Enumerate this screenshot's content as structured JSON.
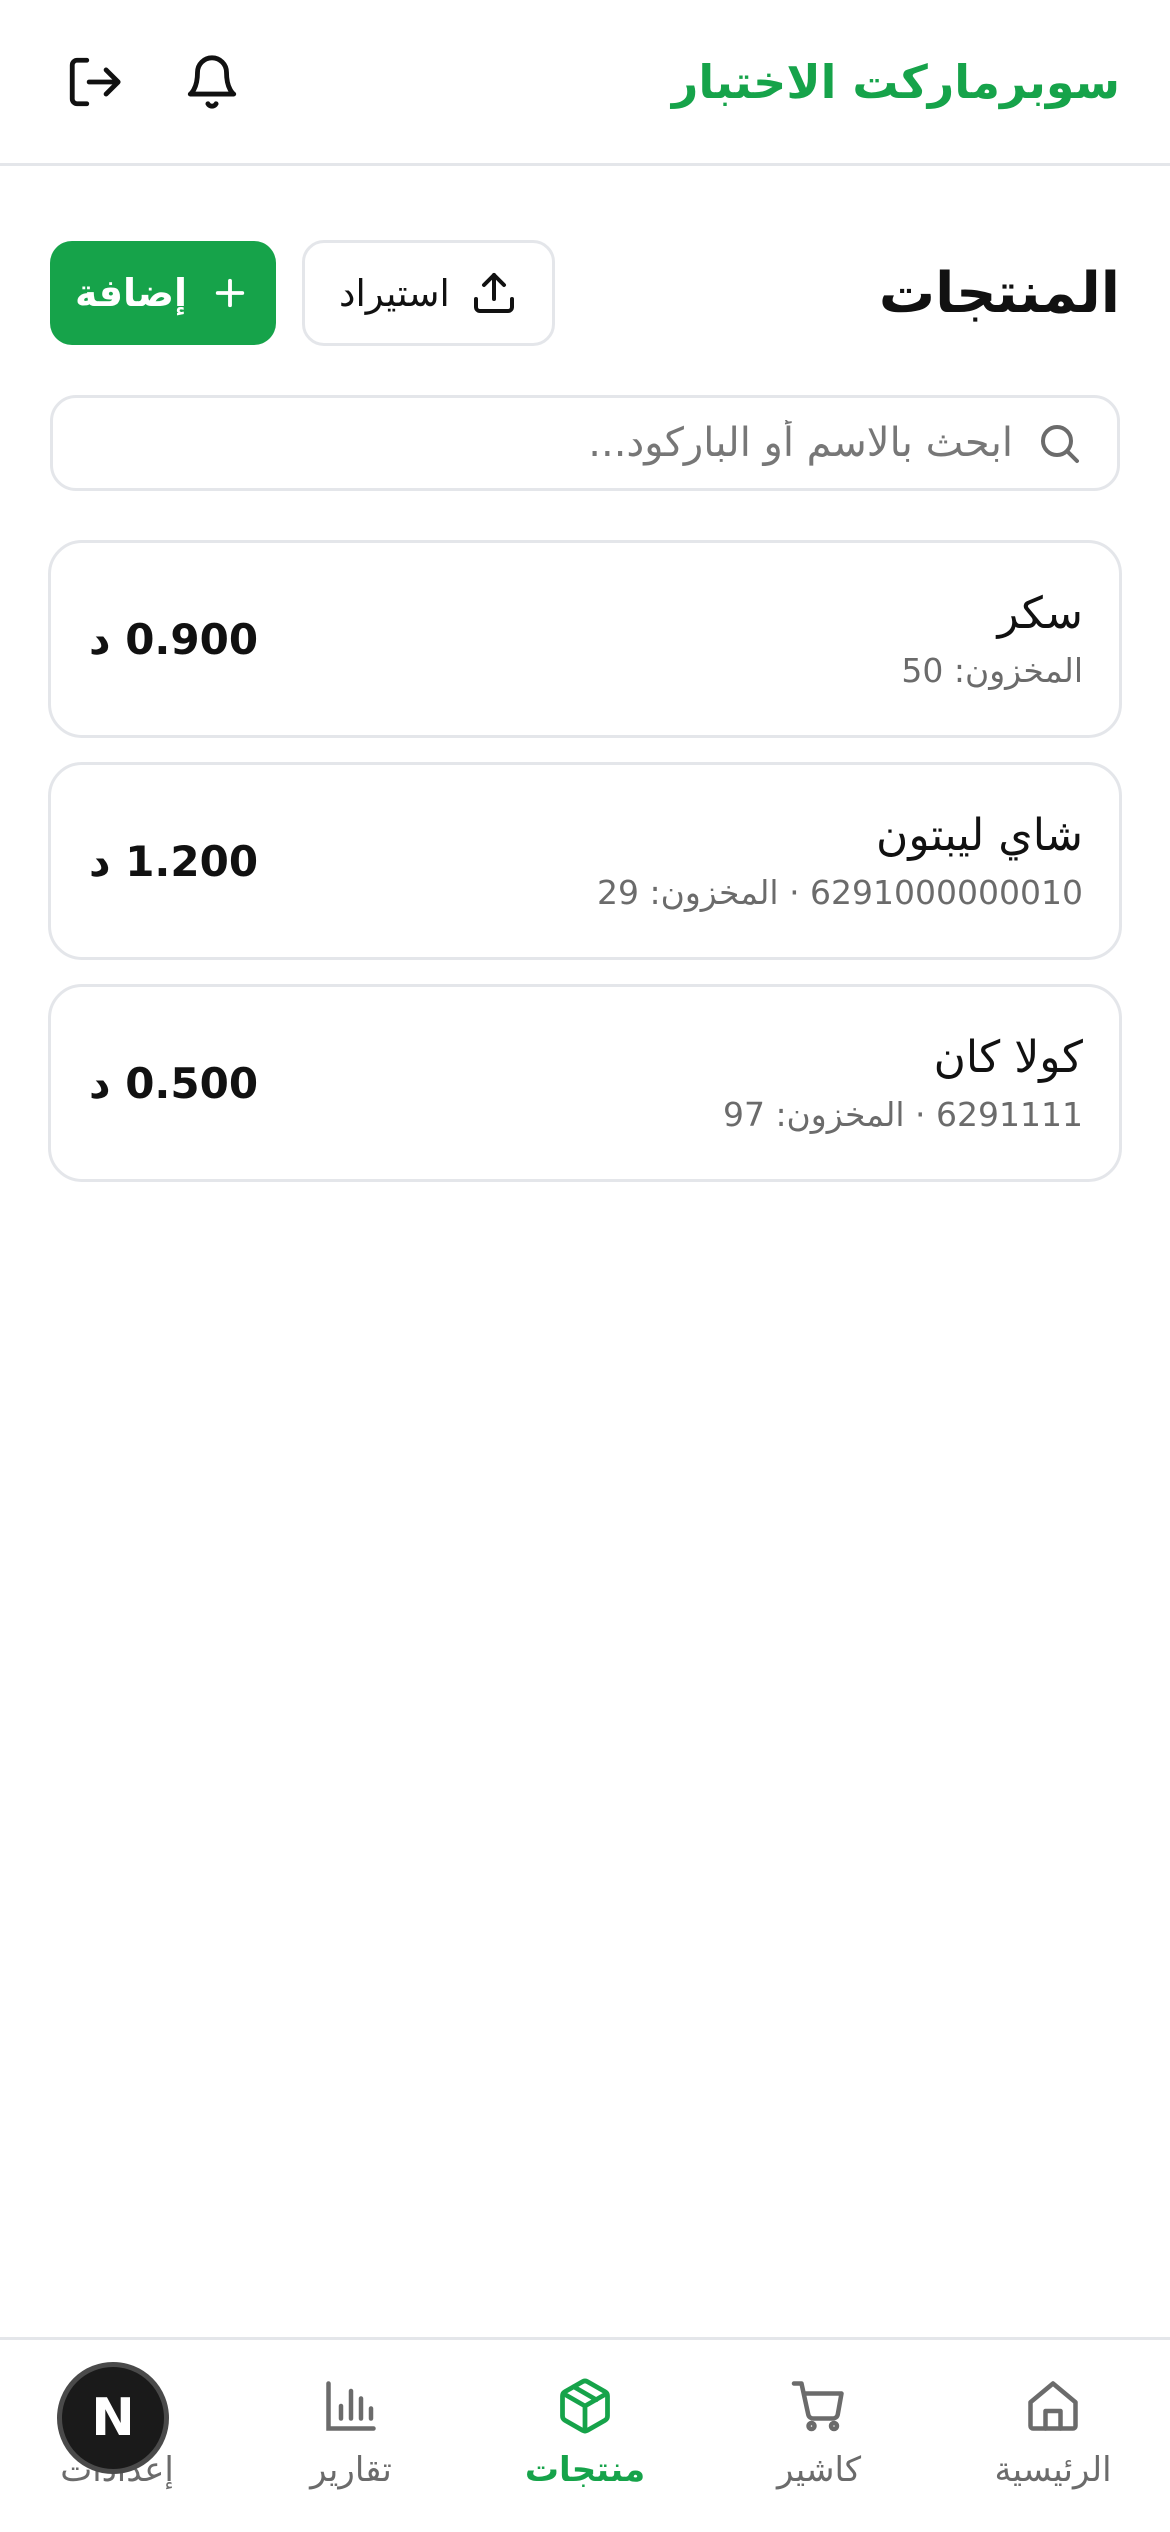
{
  "header": {
    "brand": "سوبرماركت الاختبار",
    "notifications_icon": "bell-icon",
    "logout_icon": "logout-icon"
  },
  "page": {
    "title": "المنتجات",
    "import_label": "استيراد",
    "add_label": "إضافة"
  },
  "search": {
    "placeholder": "ابحث بالاسم أو الباركود...",
    "value": ""
  },
  "products": [
    {
      "name": "سكر",
      "meta": "المخزون: 50",
      "price": "0.900 د"
    },
    {
      "name": "شاي ليبتون",
      "meta": "6291000000010 · المخزون: 29",
      "price": "1.200 د"
    },
    {
      "name": "كولا كان",
      "meta": "6291111 · المخزون: 97",
      "price": "0.500 د"
    }
  ],
  "nav": {
    "items": [
      {
        "label": "الرئيسية",
        "icon": "home-icon",
        "active": false
      },
      {
        "label": "كاشير",
        "icon": "cart-icon",
        "active": false
      },
      {
        "label": "منتجات",
        "icon": "box-icon",
        "active": true
      },
      {
        "label": "تقارير",
        "icon": "bar-chart-icon",
        "active": false
      },
      {
        "label": "إعدادات",
        "icon": "settings-icon",
        "active": false
      }
    ],
    "overlay_badge": "N"
  },
  "colors": {
    "accent": "#16a34a",
    "border": "#e4e6ea",
    "muted": "#6b6b6b"
  }
}
